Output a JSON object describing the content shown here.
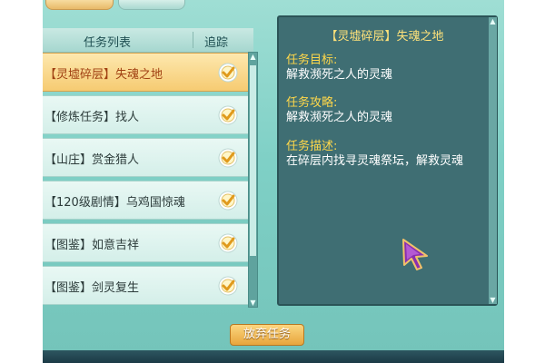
{
  "list": {
    "header_title": "任务列表",
    "header_track": "追踪",
    "items": [
      {
        "label": "【灵墟碎层】失魂之地",
        "tracked": true,
        "active": true
      },
      {
        "label": "【修炼任务】找人",
        "tracked": true,
        "active": false
      },
      {
        "label": "【山庄】赏金猎人",
        "tracked": true,
        "active": false
      },
      {
        "label": "【120级剧情】乌鸡国惊魂",
        "tracked": true,
        "active": false
      },
      {
        "label": "【图鉴】如意吉祥",
        "tracked": true,
        "active": false
      },
      {
        "label": "【图鉴】剑灵复生",
        "tracked": true,
        "active": false
      }
    ]
  },
  "detail": {
    "title": "【灵墟碎层】失魂之地",
    "goal_label": "任务目标:",
    "goal_text": "解救濒死之人的灵魂",
    "guide_label": "任务攻略:",
    "guide_text": "解救濒死之人的灵魂",
    "desc_label": "任务描述:",
    "desc_text": "在碎层内找寻灵魂祭坛，解救灵魂"
  },
  "actions": {
    "abandon_label": "放弃任务"
  },
  "colors": {
    "accent_yellow": "#ffd84a",
    "active_row": "#f6cb72",
    "panel_teal": "#7fd0c6",
    "detail_bg": "#3f6e73"
  }
}
